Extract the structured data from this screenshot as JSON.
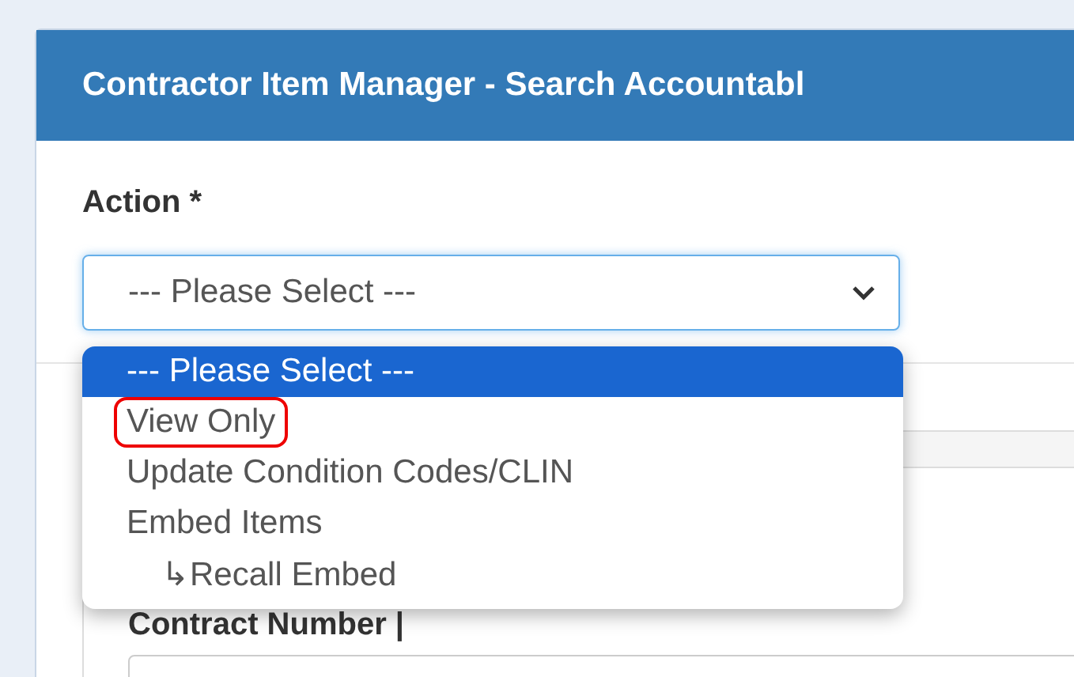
{
  "panel": {
    "title": "Contractor Item Manager - Search Accountabl"
  },
  "action": {
    "label": "Action *",
    "value": "--- Please Select ---",
    "expanded": true,
    "options": [
      {
        "label": "--- Please Select ---",
        "selected": true,
        "highlighted": false
      },
      {
        "label": "View Only",
        "selected": false,
        "highlighted": true
      },
      {
        "label": "Update Condition Codes/CLIN",
        "selected": false,
        "highlighted": false
      },
      {
        "label": "Embed Items",
        "selected": false,
        "highlighted": false,
        "children": [
          {
            "label": "↳Recall Embed",
            "selected": false,
            "highlighted": false
          }
        ]
      }
    ]
  },
  "contract": {
    "label": "Contract Number |"
  }
}
